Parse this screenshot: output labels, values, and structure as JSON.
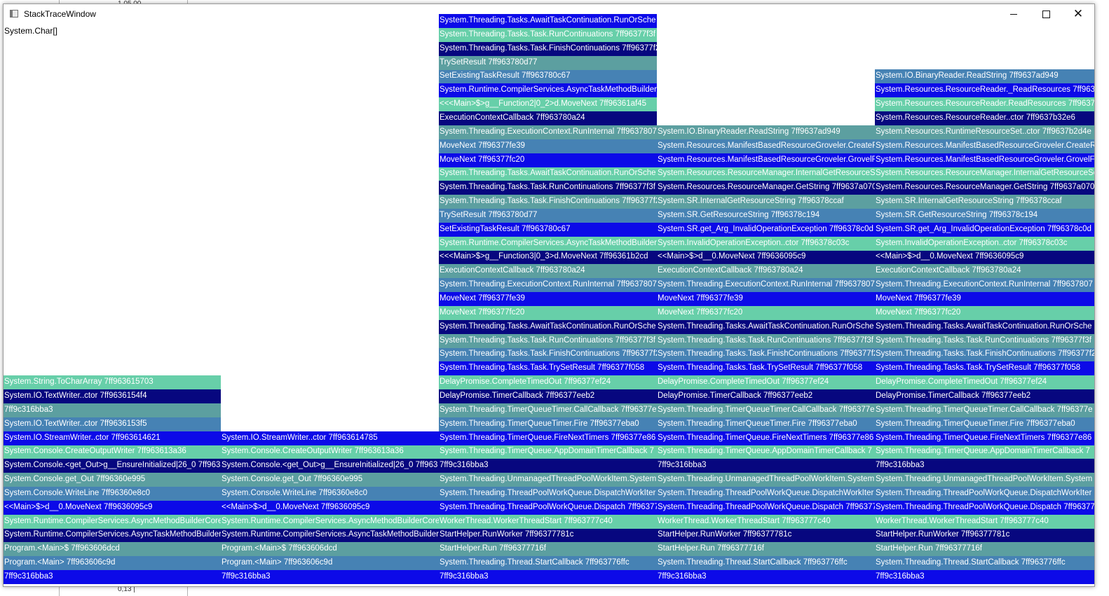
{
  "window": {
    "title": "StackTraceWindow",
    "header_label": "System.Char[]",
    "buttons": {
      "minimize": "minimize-icon",
      "maximize": "maximize-icon",
      "close": "close-icon"
    }
  },
  "background_window": {
    "tick_top": "1.05.00",
    "tick_bottom": "0,13 |"
  },
  "colors": {
    "frame_palette": [
      "#5c9fa0",
      "#0c0ae8",
      "#07077f",
      "#4682b4",
      "#67cfa9"
    ],
    "window_bg": "#ffffff"
  },
  "columns": [
    {
      "frames": [
        {
          "text": "7ff9c316bba3",
          "c": 1
        },
        {
          "text": "Program.<Main> 7ff963606c9d",
          "c": 3
        },
        {
          "text": "Program.<Main>$ 7ff963606dcd",
          "c": 0
        },
        {
          "text": "System.Runtime.CompilerServices.AsyncTaskMethodBuilder",
          "c": 2
        },
        {
          "text": "System.Runtime.CompilerServices.AsyncMethodBuilderCore",
          "c": 4
        },
        {
          "text": "<<Main>$>d__0.MoveNext 7ff9636095c9",
          "c": 1
        },
        {
          "text": "System.Console.WriteLine 7ff96360e8c0",
          "c": 3
        },
        {
          "text": "System.Console.get_Out 7ff96360e995",
          "c": 0
        },
        {
          "text": "System.Console.<get_Out>g__EnsureInitialized|26_0 7ff963",
          "c": 2
        },
        {
          "text": "System.Console.CreateOutputWriter 7ff963613a36",
          "c": 4
        },
        {
          "text": "System.IO.StreamWriter..ctor 7ff963614621",
          "c": 1
        },
        {
          "text": "System.IO.TextWriter..ctor 7ff9636153f5",
          "c": 3
        },
        {
          "text": "7ff9c316bba3",
          "c": 0
        },
        {
          "text": "System.IO.TextWriter..ctor 7ff9636154f4",
          "c": 2
        },
        {
          "text": "System.String.ToCharArray 7ff963615703",
          "c": 4
        }
      ]
    },
    {
      "frames": [
        {
          "text": "7ff9c316bba3",
          "c": 1
        },
        {
          "text": "Program.<Main> 7ff963606c9d",
          "c": 3
        },
        {
          "text": "Program.<Main>$ 7ff963606dcd",
          "c": 0
        },
        {
          "text": "System.Runtime.CompilerServices.AsyncTaskMethodBuilder",
          "c": 2
        },
        {
          "text": "System.Runtime.CompilerServices.AsyncMethodBuilderCore",
          "c": 4
        },
        {
          "text": "<<Main>$>d__0.MoveNext 7ff9636095c9",
          "c": 1
        },
        {
          "text": "System.Console.WriteLine 7ff96360e8c0",
          "c": 3
        },
        {
          "text": "System.Console.get_Out 7ff96360e995",
          "c": 0
        },
        {
          "text": "System.Console.<get_Out>g__EnsureInitialized|26_0 7ff963",
          "c": 2
        },
        {
          "text": "System.Console.CreateOutputWriter 7ff963613a36",
          "c": 4
        },
        {
          "text": "System.IO.StreamWriter..ctor 7ff963614785",
          "c": 1
        }
      ]
    },
    {
      "frames": [
        {
          "text": "7ff9c316bba3",
          "c": 1
        },
        {
          "text": "System.Threading.Thread.StartCallback 7ff963776ffc",
          "c": 3
        },
        {
          "text": "StartHelper.Run 7ff96377716f",
          "c": 0
        },
        {
          "text": "StartHelper.RunWorker 7ff96377781c",
          "c": 2
        },
        {
          "text": "WorkerThread.WorkerThreadStart 7ff963777c40",
          "c": 4
        },
        {
          "text": "System.Threading.ThreadPoolWorkQueue.Dispatch 7ff96377",
          "c": 1
        },
        {
          "text": "System.Threading.ThreadPoolWorkQueue.DispatchWorkIter",
          "c": 3
        },
        {
          "text": "System.Threading.UnmanagedThreadPoolWorkItem.System",
          "c": 0
        },
        {
          "text": "7ff9c316bba3",
          "c": 2
        },
        {
          "text": "System.Threading.TimerQueue.AppDomainTimerCallback 7",
          "c": 4
        },
        {
          "text": "System.Threading.TimerQueue.FireNextTimers 7ff96377e86",
          "c": 1
        },
        {
          "text": "System.Threading.TimerQueueTimer.Fire 7ff96377eba0",
          "c": 3
        },
        {
          "text": "System.Threading.TimerQueueTimer.CallCallback 7ff96377e",
          "c": 0
        },
        {
          "text": "DelayPromise.TimerCallback 7ff96377eeb2",
          "c": 2
        },
        {
          "text": "DelayPromise.CompleteTimedOut 7ff96377ef24",
          "c": 4
        },
        {
          "text": "System.Threading.Tasks.Task.TrySetResult 7ff96377f058",
          "c": 1
        },
        {
          "text": "System.Threading.Tasks.Task.FinishContinuations 7ff96377f2",
          "c": 3
        },
        {
          "text": "System.Threading.Tasks.Task.RunContinuations 7ff96377f3f",
          "c": 0
        },
        {
          "text": "System.Threading.Tasks.AwaitTaskContinuation.RunOrSche",
          "c": 2
        },
        {
          "text": "MoveNext 7ff96377fc20",
          "c": 4
        },
        {
          "text": "MoveNext 7ff96377fe39",
          "c": 1
        },
        {
          "text": "System.Threading.ExecutionContext.RunInternal 7ff9637807",
          "c": 3
        },
        {
          "text": "ExecutionContextCallback 7ff963780a24",
          "c": 0
        },
        {
          "text": "<<<Main>$>g__Function3|0_3>d.MoveNext 7ff96361b2cd",
          "c": 2
        },
        {
          "text": "System.Runtime.CompilerServices.AsyncTaskMethodBuilder",
          "c": 4
        },
        {
          "text": "SetExistingTaskResult 7ff963780c67",
          "c": 1
        },
        {
          "text": "TrySetResult 7ff963780d77",
          "c": 3
        },
        {
          "text": "System.Threading.Tasks.Task.FinishContinuations 7ff96377f2",
          "c": 0
        },
        {
          "text": "System.Threading.Tasks.Task.RunContinuations 7ff96377f3f",
          "c": 2
        },
        {
          "text": "System.Threading.Tasks.AwaitTaskContinuation.RunOrSche",
          "c": 4
        },
        {
          "text": "MoveNext 7ff96377fc20",
          "c": 1
        },
        {
          "text": "MoveNext 7ff96377fe39",
          "c": 3
        },
        {
          "text": "System.Threading.ExecutionContext.RunInternal 7ff9637807",
          "c": 0
        },
        {
          "text": "ExecutionContextCallback 7ff963780a24",
          "c": 2
        },
        {
          "text": "<<<Main>$>g__Function2|0_2>d.MoveNext 7ff96361af45",
          "c": 4
        },
        {
          "text": "System.Runtime.CompilerServices.AsyncTaskMethodBuilder",
          "c": 1
        },
        {
          "text": "SetExistingTaskResult 7ff963780c67",
          "c": 3
        },
        {
          "text": "TrySetResult 7ff963780d77",
          "c": 0
        },
        {
          "text": "System.Threading.Tasks.Task.FinishContinuations 7ff96377f2",
          "c": 2
        },
        {
          "text": "System.Threading.Tasks.Task.RunContinuations 7ff96377f3f",
          "c": 4
        },
        {
          "text": "System.Threading.Tasks.AwaitTaskContinuation.RunOrSche",
          "c": 1
        }
      ]
    },
    {
      "frames": [
        {
          "text": "7ff9c316bba3",
          "c": 1
        },
        {
          "text": "System.Threading.Thread.StartCallback 7ff963776ffc",
          "c": 3
        },
        {
          "text": "StartHelper.Run 7ff96377716f",
          "c": 0
        },
        {
          "text": "StartHelper.RunWorker 7ff96377781c",
          "c": 2
        },
        {
          "text": "WorkerThread.WorkerThreadStart 7ff963777c40",
          "c": 4
        },
        {
          "text": "System.Threading.ThreadPoolWorkQueue.Dispatch 7ff96377",
          "c": 1
        },
        {
          "text": "System.Threading.ThreadPoolWorkQueue.DispatchWorkIter",
          "c": 3
        },
        {
          "text": "System.Threading.UnmanagedThreadPoolWorkItem.System",
          "c": 0
        },
        {
          "text": "7ff9c316bba3",
          "c": 2
        },
        {
          "text": "System.Threading.TimerQueue.AppDomainTimerCallback 7",
          "c": 4
        },
        {
          "text": "System.Threading.TimerQueue.FireNextTimers 7ff96377e86",
          "c": 1
        },
        {
          "text": "System.Threading.TimerQueueTimer.Fire 7ff96377eba0",
          "c": 3
        },
        {
          "text": "System.Threading.TimerQueueTimer.CallCallback 7ff96377e",
          "c": 0
        },
        {
          "text": "DelayPromise.TimerCallback 7ff96377eeb2",
          "c": 2
        },
        {
          "text": "DelayPromise.CompleteTimedOut 7ff96377ef24",
          "c": 4
        },
        {
          "text": "System.Threading.Tasks.Task.TrySetResult 7ff96377f058",
          "c": 1
        },
        {
          "text": "System.Threading.Tasks.Task.FinishContinuations 7ff96377f2",
          "c": 3
        },
        {
          "text": "System.Threading.Tasks.Task.RunContinuations 7ff96377f3f",
          "c": 0
        },
        {
          "text": "System.Threading.Tasks.AwaitTaskContinuation.RunOrSche",
          "c": 2
        },
        {
          "text": "MoveNext 7ff96377fc20",
          "c": 4
        },
        {
          "text": "MoveNext 7ff96377fe39",
          "c": 1
        },
        {
          "text": "System.Threading.ExecutionContext.RunInternal 7ff9637807",
          "c": 3
        },
        {
          "text": "ExecutionContextCallback 7ff963780a24",
          "c": 0
        },
        {
          "text": "<<Main>$>d__0.MoveNext 7ff9636095c9",
          "c": 2
        },
        {
          "text": "System.InvalidOperationException..ctor 7ff96378c03c",
          "c": 4
        },
        {
          "text": "System.SR.get_Arg_InvalidOperationException 7ff96378c0d",
          "c": 1
        },
        {
          "text": "System.SR.GetResourceString 7ff96378c194",
          "c": 3
        },
        {
          "text": "System.SR.InternalGetResourceString 7ff96378ccaf",
          "c": 0
        },
        {
          "text": "System.Resources.ResourceManager.GetString 7ff9637a070",
          "c": 2
        },
        {
          "text": "System.Resources.ResourceManager.InternalGetResourceSe",
          "c": 4
        },
        {
          "text": "System.Resources.ManifestBasedResourceGroveler.GrovelFo",
          "c": 1
        },
        {
          "text": "System.Resources.ManifestBasedResourceGroveler.CreateRe",
          "c": 3
        },
        {
          "text": "System.IO.BinaryReader.ReadString 7ff9637ad949",
          "c": 0
        }
      ]
    },
    {
      "frames": [
        {
          "text": "7ff9c316bba3",
          "c": 1
        },
        {
          "text": "System.Threading.Thread.StartCallback 7ff963776ffc",
          "c": 3
        },
        {
          "text": "StartHelper.Run 7ff96377716f",
          "c": 0
        },
        {
          "text": "StartHelper.RunWorker 7ff96377781c",
          "c": 2
        },
        {
          "text": "WorkerThread.WorkerThreadStart 7ff963777c40",
          "c": 4
        },
        {
          "text": "System.Threading.ThreadPoolWorkQueue.Dispatch 7ff96377",
          "c": 1
        },
        {
          "text": "System.Threading.ThreadPoolWorkQueue.DispatchWorkIter",
          "c": 3
        },
        {
          "text": "System.Threading.UnmanagedThreadPoolWorkItem.System",
          "c": 0
        },
        {
          "text": "7ff9c316bba3",
          "c": 2
        },
        {
          "text": "System.Threading.TimerQueue.AppDomainTimerCallback 7",
          "c": 4
        },
        {
          "text": "System.Threading.TimerQueue.FireNextTimers 7ff96377e86",
          "c": 1
        },
        {
          "text": "System.Threading.TimerQueueTimer.Fire 7ff96377eba0",
          "c": 3
        },
        {
          "text": "System.Threading.TimerQueueTimer.CallCallback 7ff96377e",
          "c": 0
        },
        {
          "text": "DelayPromise.TimerCallback 7ff96377eeb2",
          "c": 2
        },
        {
          "text": "DelayPromise.CompleteTimedOut 7ff96377ef24",
          "c": 4
        },
        {
          "text": "System.Threading.Tasks.Task.TrySetResult 7ff96377f058",
          "c": 1
        },
        {
          "text": "System.Threading.Tasks.Task.FinishContinuations 7ff96377f2",
          "c": 3
        },
        {
          "text": "System.Threading.Tasks.Task.RunContinuations 7ff96377f3f",
          "c": 0
        },
        {
          "text": "System.Threading.Tasks.AwaitTaskContinuation.RunOrSche",
          "c": 2
        },
        {
          "text": "MoveNext 7ff96377fc20",
          "c": 4
        },
        {
          "text": "MoveNext 7ff96377fe39",
          "c": 1
        },
        {
          "text": "System.Threading.ExecutionContext.RunInternal 7ff9637807",
          "c": 3
        },
        {
          "text": "ExecutionContextCallback 7ff963780a24",
          "c": 0
        },
        {
          "text": "<<Main>$>d__0.MoveNext 7ff9636095c9",
          "c": 2
        },
        {
          "text": "System.InvalidOperationException..ctor 7ff96378c03c",
          "c": 4
        },
        {
          "text": "System.SR.get_Arg_InvalidOperationException 7ff96378c0d",
          "c": 1
        },
        {
          "text": "System.SR.GetResourceString 7ff96378c194",
          "c": 3
        },
        {
          "text": "System.SR.InternalGetResourceString 7ff96378ccaf",
          "c": 0
        },
        {
          "text": "System.Resources.ResourceManager.GetString 7ff9637a070",
          "c": 2
        },
        {
          "text": "System.Resources.ResourceManager.InternalGetResourceSe",
          "c": 4
        },
        {
          "text": "System.Resources.ManifestBasedResourceGroveler.GrovelFo",
          "c": 1
        },
        {
          "text": "System.Resources.ManifestBasedResourceGroveler.CreateRe",
          "c": 3
        },
        {
          "text": "System.Resources.RuntimeResourceSet..ctor 7ff9637b2d4e",
          "c": 0
        },
        {
          "text": "System.Resources.ResourceReader..ctor 7ff9637b32e6",
          "c": 2
        },
        {
          "text": "System.Resources.ResourceReader.ReadResources 7ff9637b",
          "c": 4
        },
        {
          "text": "System.Resources.ResourceReader._ReadResources 7ff9637",
          "c": 1
        },
        {
          "text": "System.IO.BinaryReader.ReadString 7ff9637ad949",
          "c": 3
        }
      ]
    }
  ]
}
